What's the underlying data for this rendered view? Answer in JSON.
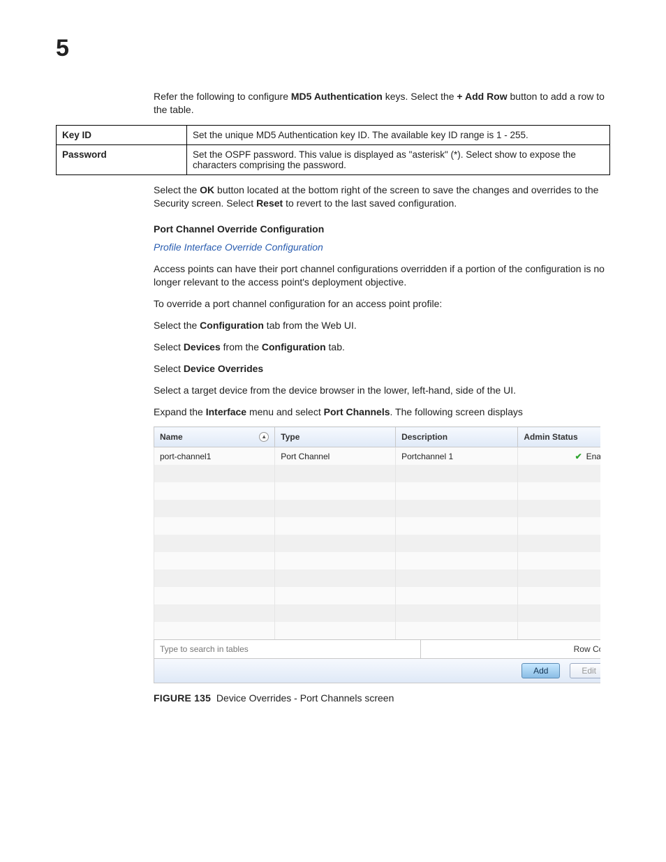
{
  "chapter_number": "5",
  "intro_para": {
    "pre": "Refer the following to configure ",
    "b1": "MD5 Authentication",
    "mid": " keys. Select the ",
    "b2": "+ Add Row",
    "post": " button to add a row to the table."
  },
  "def_table": {
    "rows": [
      {
        "key": "Key ID",
        "val": "Set the unique MD5 Authentication key ID. The available key ID range is 1 - 255."
      },
      {
        "key": "Password",
        "val": "Set the OSPF password. This value is displayed as \"asterisk\" (*). Select show to expose the characters comprising the password."
      }
    ]
  },
  "para2": {
    "p1a": "Select the ",
    "p1b": "OK",
    "p1c": " button located at the bottom right of the screen to save the changes and overrides to the Security screen. Select ",
    "p1d": "Reset",
    "p1e": " to revert to the last saved configuration."
  },
  "sub_heading": "Port Channel Override Configuration",
  "link_text": "Profile Interface Override Configuration",
  "para3": "Access points can have their port channel configurations overridden if a portion of the configuration is no longer relevant to the access point's deployment objective.",
  "para4": "To override a port channel configuration for an access point profile:",
  "step1": {
    "a": "Select the ",
    "b": "Configuration",
    "c": " tab from the Web UI."
  },
  "step2": {
    "a": "Select ",
    "b": "Devices",
    "c": " from the ",
    "d": "Configuration",
    "e": " tab."
  },
  "step3": {
    "a": "Select ",
    "b": "Device Overrides"
  },
  "step4": "Select a target device from the device browser in the lower, left-hand, side of the UI.",
  "step5": {
    "a": "Expand the ",
    "b": "Interface",
    "c": " menu and select ",
    "d": "Port Channels",
    "e": ". The following screen displays"
  },
  "grid": {
    "headers": {
      "name": "Name",
      "type": "Type",
      "desc": "Description",
      "status": "Admin Status"
    },
    "row1": {
      "name": "port-channel1",
      "type": "Port Channel",
      "desc": "Portchannel 1",
      "status": "Enable"
    },
    "search_placeholder": "Type to search in tables",
    "rowcount_label": "Row Cou",
    "add_btn": "Add",
    "edit_btn": "Edit"
  },
  "figure": {
    "num": "FIGURE 135",
    "caption": "Device Overrides - Port Channels screen"
  }
}
